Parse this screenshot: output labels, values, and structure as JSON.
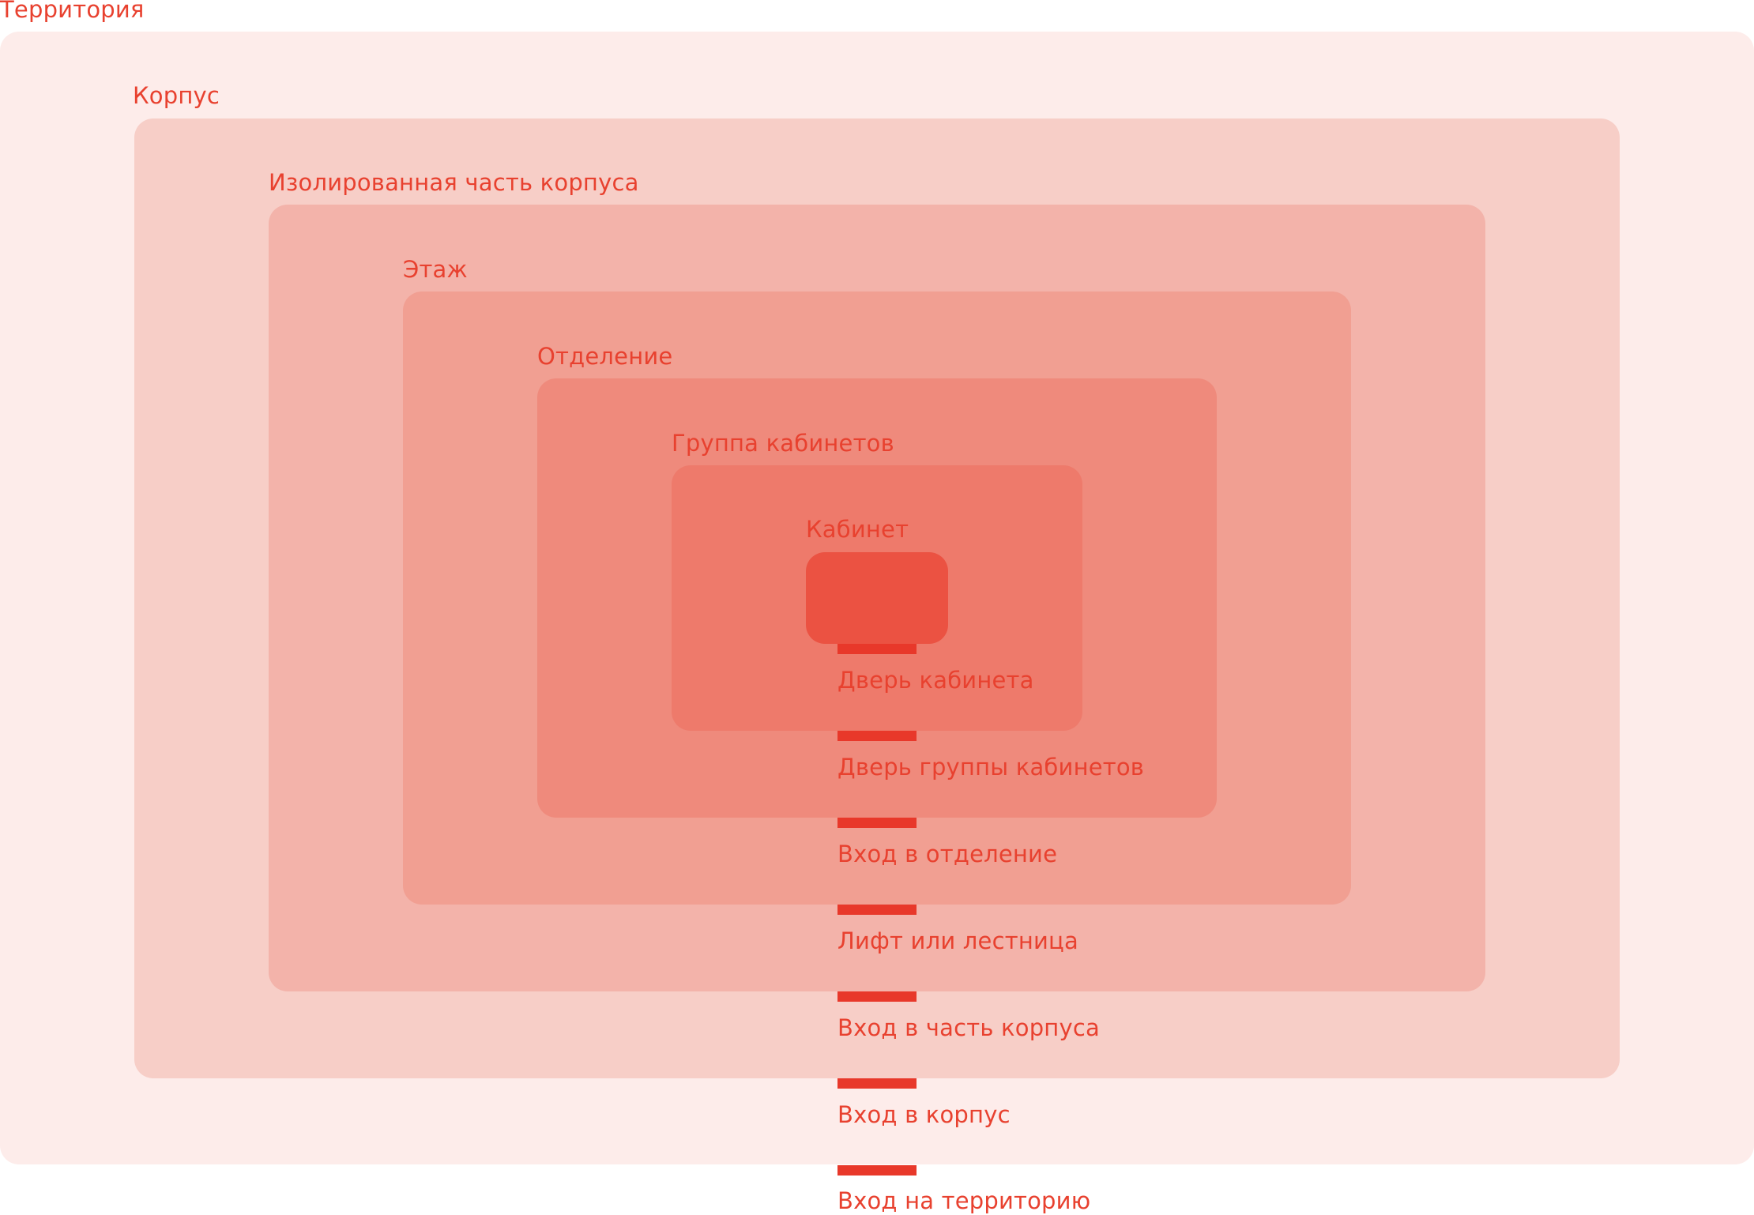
{
  "colors": {
    "label": "#e8412f",
    "door": "#e8382a",
    "zone_territory": "#fdecea",
    "zone_building": "#f7cec7",
    "zone_isolated": "#f3b3aa",
    "zone_floor": "#f19f92",
    "zone_department": "#ef8a7c",
    "zone_room_group": "#ee7a6b",
    "zone_room": "#eb5242"
  },
  "zones": [
    {
      "id": "territory",
      "label": "Территория"
    },
    {
      "id": "building",
      "label": "Корпус"
    },
    {
      "id": "isolated",
      "label": "Изолированная часть корпуса"
    },
    {
      "id": "floor",
      "label": "Этаж"
    },
    {
      "id": "department",
      "label": "Отделение"
    },
    {
      "id": "room_group",
      "label": "Группа кабинетов"
    },
    {
      "id": "room",
      "label": "Кабинет"
    }
  ],
  "doors": [
    {
      "label": "Дверь кабинета"
    },
    {
      "label": "Дверь группы кабинетов"
    },
    {
      "label": "Вход в отделение"
    },
    {
      "label": "Лифт или лестница"
    },
    {
      "label": "Вход в часть корпуса"
    },
    {
      "label": "Вход в корпус"
    },
    {
      "label": "Вход на территорию"
    }
  ]
}
